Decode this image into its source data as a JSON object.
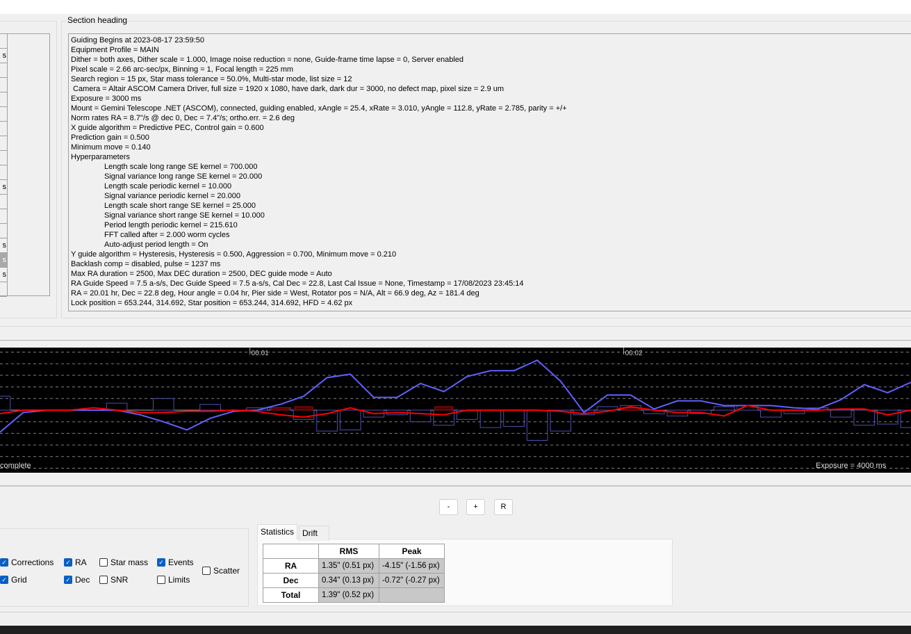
{
  "section": {
    "heading": "Section heading",
    "lines": [
      {
        "text": "Guiding Begins at 2023-08-17 23:59:50",
        "indent": false
      },
      {
        "text": "Equipment Profile = MAIN",
        "indent": false
      },
      {
        "text": "Dither = both axes, Dither scale = 1.000, Image noise reduction = none, Guide-frame time lapse = 0, Server enabled",
        "indent": false
      },
      {
        "text": "Pixel scale = 2.66 arc-sec/px, Binning = 1, Focal length = 225 mm",
        "indent": false
      },
      {
        "text": "Search region = 15 px, Star mass tolerance = 50.0%, Multi-star mode, list size = 12",
        "indent": false
      },
      {
        "text": " Camera = Altair ASCOM Camera Driver, full size = 1920 x 1080, have dark, dark dur = 3000, no defect map, pixel size = 2.9 um",
        "indent": false
      },
      {
        "text": "Exposure = 3000 ms",
        "indent": false
      },
      {
        "text": "Mount = Gemini Telescope .NET (ASCOM), connected, guiding enabled, xAngle = 25.4, xRate = 3.010, yAngle = 112.8, yRate = 2.785, parity = +/+",
        "indent": false
      },
      {
        "text": "Norm rates RA = 8.7\"/s @ dec 0, Dec = 7.4\"/s; ortho.err. = 2.6 deg",
        "indent": false
      },
      {
        "text": "X guide algorithm = Predictive PEC, Control gain = 0.600",
        "indent": false
      },
      {
        "text": "Prediction gain = 0.500",
        "indent": false
      },
      {
        "text": "Minimum move = 0.140",
        "indent": false
      },
      {
        "text": "Hyperparameters",
        "indent": false
      },
      {
        "text": "Length scale long range SE kernel = 700.000",
        "indent": true
      },
      {
        "text": "Signal variance long range SE kernel = 20.000",
        "indent": true
      },
      {
        "text": "Length scale periodic kernel = 10.000",
        "indent": true
      },
      {
        "text": "Signal variance periodic kernel = 20.000",
        "indent": true
      },
      {
        "text": "Length scale short range SE kernel = 25.000",
        "indent": true
      },
      {
        "text": "Signal variance short range SE kernel = 10.000",
        "indent": true
      },
      {
        "text": "Period length periodic kernel = 215.610",
        "indent": true
      },
      {
        "text": "FFT called after = 2.000 worm cycles",
        "indent": true
      },
      {
        "text": "Auto-adjust period length = On",
        "indent": true
      },
      {
        "text": "Y guide algorithm = Hysteresis, Hysteresis = 0.500, Aggression = 0.700, Minimum move = 0.210",
        "indent": false
      },
      {
        "text": "Backlash comp = disabled, pulse = 1237 ms",
        "indent": false
      },
      {
        "text": "Max RA duration = 2500, Max DEC duration = 2500, DEC guide mode = Auto",
        "indent": false
      },
      {
        "text": "RA Guide Speed = 7.5 a-s/s, Dec Guide Speed = 7.5 a-s/s, Cal Dec = 22.8, Last Cal Issue = None, Timestamp = 17/08/2023 23:45:14",
        "indent": false
      },
      {
        "text": "RA = 20.01 hr, Dec = 22.8 deg, Hour angle = 0.04 hr, Pier side = West, Rotator pos = N/A, Alt = 66.9 deg, Az = 181.4 deg",
        "indent": false
      },
      {
        "text": "Lock position = 653.244, 314.692, Star position = 653.244, 314.692, HFD = 4.62 px",
        "indent": false
      }
    ]
  },
  "left_list": {
    "rows": [
      "",
      "s",
      "",
      "",
      "",
      "",
      "",
      "",
      "",
      "",
      "s",
      "",
      "",
      "",
      "s",
      "s",
      "s",
      ""
    ],
    "selected_index": 15
  },
  "graph": {
    "status_left": "complete",
    "status_right": "Exposure = 4000 ms",
    "colors": {
      "ra": "#6060ff",
      "dec": "#ff0000",
      "grid": "#808080"
    },
    "chart_data": {
      "type": "line",
      "x_ticks": [
        {
          "label": "00:01",
          "sample": 10.7
        },
        {
          "label": "00:02",
          "sample": 26.7
        }
      ],
      "ylim": [
        -5.4,
        5.4
      ],
      "grid": true,
      "series": [
        {
          "name": "RA",
          "values": [
            -1.9,
            -0.2,
            0,
            0,
            0,
            0,
            -0.4,
            -1.0,
            -1.7,
            -0.7,
            -0.1,
            0,
            0.5,
            1.2,
            2.8,
            3.1,
            1.1,
            1.1,
            2.3,
            1.6,
            2.9,
            3.4,
            3.4,
            4.3,
            2.5,
            -0.2,
            1.3,
            1.3,
            0.1,
            0.8,
            0.8,
            0.4,
            0.4,
            0.4,
            0.2,
            0.1,
            0.9,
            2.2,
            1.5,
            2.4
          ]
        },
        {
          "name": "Dec",
          "values": [
            -0.3,
            0,
            0,
            0,
            0.2,
            0,
            -0.2,
            -0.2,
            -0.1,
            -0.1,
            0,
            -0.1,
            -0.4,
            -0.6,
            -0.3,
            0.2,
            -0.3,
            -0.2,
            -0.3,
            -0.4,
            0,
            0,
            0,
            0,
            -0.1,
            -0.3,
            -0.1,
            0.3,
            0,
            -0.2,
            -0.2,
            -0.5,
            0.4,
            0,
            0,
            0,
            0.1,
            0.1,
            -0.4,
            0
          ]
        }
      ],
      "corrections": {
        "ra": [
          1.2,
          0,
          0,
          0,
          0,
          0.6,
          0,
          1.0,
          0,
          0.5,
          0,
          0.2,
          0.2,
          -0.8,
          -1.8,
          -1.7,
          -0.6,
          -0.4,
          -1.0,
          -1.3,
          -0.8,
          -1.5,
          -1.4,
          -2.6,
          -1.8,
          -0.4,
          0.3,
          0.4,
          -0.3,
          -0.5,
          -0.3,
          0.3,
          0.4,
          -0.6,
          -0.3,
          0.2,
          -0.6,
          -1.3,
          -1.2,
          -1.5
        ],
        "dec": [
          0,
          0,
          0,
          0,
          0,
          0,
          0,
          0,
          0,
          0,
          0,
          0,
          0.2,
          0.3,
          0,
          0,
          0,
          0,
          0,
          0.3,
          0,
          0,
          0,
          0,
          0,
          0,
          0,
          0.2,
          0,
          0,
          0,
          0,
          0,
          0,
          0,
          0,
          0,
          0,
          0,
          0
        ]
      }
    }
  },
  "zoom_buttons": {
    "minus": "-",
    "plus": "+",
    "reset": "R"
  },
  "options": [
    {
      "label": "Corrections",
      "checked": true
    },
    {
      "label": "RA",
      "checked": true
    },
    {
      "label": "Star mass",
      "checked": false
    },
    {
      "label": "Events",
      "checked": true
    },
    {
      "label": "Grid",
      "checked": true
    },
    {
      "label": "Dec",
      "checked": true
    },
    {
      "label": "SNR",
      "checked": false
    },
    {
      "label": "Limits",
      "checked": false
    },
    {
      "label": "Scatter",
      "checked": false
    }
  ],
  "tabs": {
    "statistics": "Statistics",
    "drift": "Drift"
  },
  "stats": {
    "headers": [
      "RMS",
      "Peak"
    ],
    "rows": [
      {
        "label": "RA",
        "rms": "1.35\" (0.51 px)",
        "peak": "-4.15\" (-1.56 px)"
      },
      {
        "label": "Dec",
        "rms": "0.34\" (0.13 px)",
        "peak": "-0.72\" (-0.27 px)"
      },
      {
        "label": "Total",
        "rms": "1.39\" (0.52 px)",
        "peak": ""
      }
    ]
  }
}
